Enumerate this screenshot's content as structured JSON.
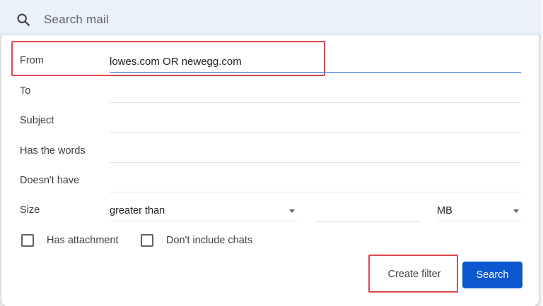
{
  "search": {
    "placeholder": "Search mail",
    "icon": "search-icon"
  },
  "filter": {
    "from": {
      "label": "From",
      "value": "lowes.com OR newegg.com"
    },
    "to": {
      "label": "To",
      "value": ""
    },
    "subject": {
      "label": "Subject",
      "value": ""
    },
    "has_words": {
      "label": "Has the words",
      "value": ""
    },
    "doesnt_have": {
      "label": "Doesn't have",
      "value": ""
    },
    "size": {
      "label": "Size",
      "operator": "greater than",
      "value": "",
      "unit": "MB"
    },
    "has_attachment": {
      "label": "Has attachment",
      "checked": false
    },
    "dont_include_chats": {
      "label": "Don't include chats",
      "checked": false
    },
    "create_filter_label": "Create filter",
    "search_label": "Search"
  },
  "colors": {
    "accent": "#0b57d0",
    "highlight": "#e0474c",
    "searchbar_bg": "#eaf1fb"
  }
}
